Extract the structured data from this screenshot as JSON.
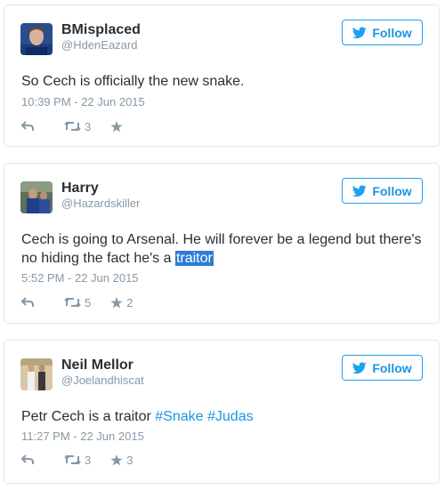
{
  "follow_label": "Follow",
  "tweets": [
    {
      "name": "BMisplaced",
      "handle": "@HdenEazard",
      "text": "So Cech is officially the new snake.",
      "time": "10:39 PM - 22 Jun 2015",
      "retweets": "3",
      "favorites": ""
    },
    {
      "name": "Harry",
      "handle": "@Hazardskiller",
      "text_before": "Cech is going to Arsenal. He will forever be a legend but there's no hiding the fact he's a ",
      "text_highlight": "traitor",
      "time": "5:52 PM - 22 Jun 2015",
      "retweets": "5",
      "favorites": "2"
    },
    {
      "name": "Neil Mellor",
      "handle": "@Joelandhiscat",
      "text_before": "Petr Cech is a traitor ",
      "hashtag_1": "#Snake",
      "hashtag_2": "#Judas",
      "time": "11:27 PM - 22 Jun 2015",
      "retweets": "3",
      "favorites": "3"
    }
  ],
  "colors": {
    "accent": "#1da1f2",
    "link": "#1b95e0",
    "muted": "#8899a6",
    "highlight": "#2f7bd6"
  },
  "icons": [
    "bird-icon",
    "reply-icon",
    "retweet-icon",
    "star-icon"
  ]
}
